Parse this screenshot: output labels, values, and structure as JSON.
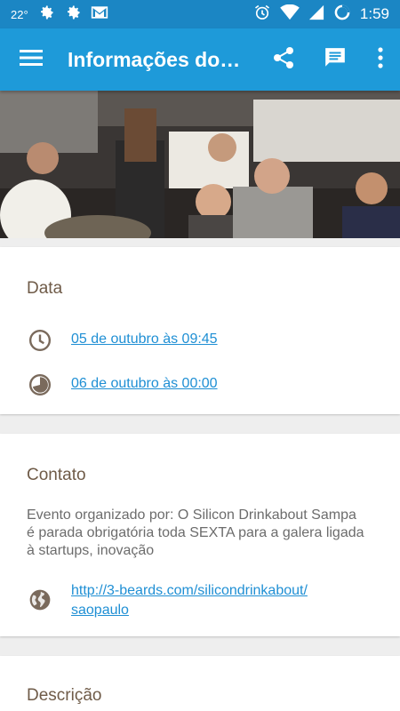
{
  "status_bar": {
    "temperature": "22°",
    "time": "1:59",
    "icons_left": [
      "settings-gear-icon",
      "settings-gear-icon",
      "gmail-icon"
    ],
    "icons_right": [
      "alarm-icon",
      "wifi-icon",
      "signal-icon",
      "sync-circle-icon"
    ]
  },
  "app_bar": {
    "title": "Informações do evento",
    "icons": [
      "menu-icon",
      "share-icon",
      "comment-icon",
      "more-vert-icon"
    ],
    "color": "#1e9ad9"
  },
  "hero": {
    "description": "event photo of people at a gathering"
  },
  "data_card": {
    "title": "Data",
    "start": "05 de outubro às 09:45",
    "end": "06 de outubro às 00:00"
  },
  "contact_card": {
    "title": "Contato",
    "description": "Evento organizado por: O Silicon Drinkabout Sampa é parada obrigatória toda SEXTA para a galera ligada à startups, inovação",
    "link_line1": "http://3-beards.com/silicondrinkabout/",
    "link_line2": "saopaulo"
  },
  "description_card": {
    "title": "Descrição"
  },
  "colors": {
    "status_bar": "#1b86c4",
    "accent_link": "#1f8fd4",
    "section_title": "#6f5b48",
    "icon": "#7a6a5c"
  }
}
